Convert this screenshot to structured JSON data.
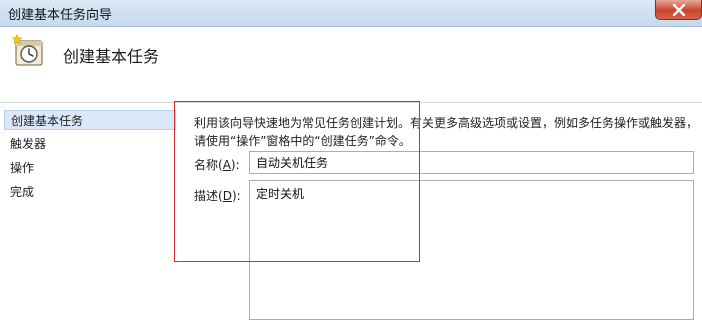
{
  "window": {
    "title": "创建基本任务向导"
  },
  "header": {
    "title": "创建基本任务",
    "icon": "task-clock-icon"
  },
  "sidebar": {
    "items": [
      {
        "label": "创建基本任务",
        "selected": true
      },
      {
        "label": "触发器",
        "selected": false
      },
      {
        "label": "操作",
        "selected": false
      },
      {
        "label": "完成",
        "selected": false
      }
    ]
  },
  "main": {
    "description": "利用该向导快速地为常见任务创建计划。有关更多高级选项或设置，例如多任务操作或触发器，请使用“操作”窗格中的“创建任务”命令。",
    "name_label": "名称",
    "name_hotkey": "A",
    "name_value": "自动关机任务",
    "desc_label": "描述",
    "desc_hotkey": "D",
    "desc_value": "定时关机"
  },
  "colors": {
    "highlight": "#d82a2a",
    "selection": "#dbe8fa",
    "close": "#c8442c"
  }
}
